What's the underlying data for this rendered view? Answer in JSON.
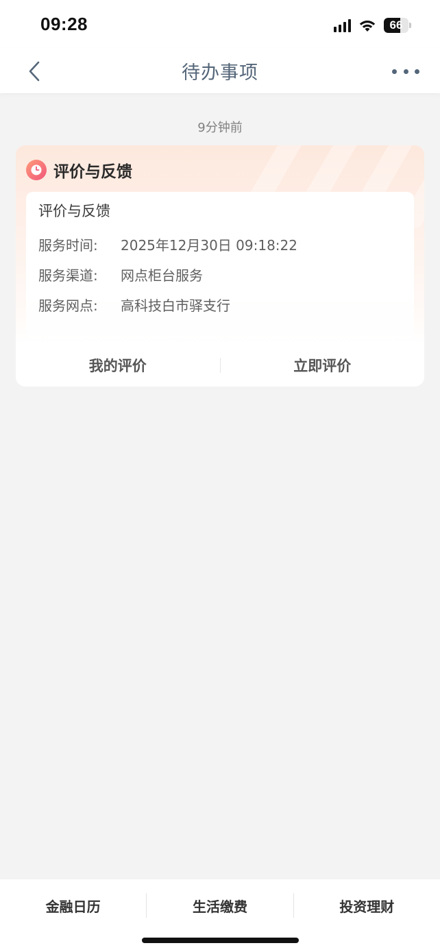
{
  "status_bar": {
    "time": "09:28",
    "battery": "66",
    "icons": [
      "signal-icon",
      "wifi-icon",
      "battery-icon"
    ]
  },
  "nav": {
    "title": "待办事项",
    "back_icon": "chevron-left-icon",
    "more_icon": "more-dots-icon"
  },
  "timestamp": "9分钟前",
  "card": {
    "icon": "clock-icon",
    "header_title": "评价与反馈",
    "body_title": "评价与反馈",
    "rows": [
      {
        "label": "服务时间:",
        "value": "2025年12月30日 09:18:22"
      },
      {
        "label": "服务渠道:",
        "value": "网点柜台服务"
      },
      {
        "label": "服务网点:",
        "value": "高科技白市驿支行"
      }
    ],
    "actions": {
      "my_review": "我的评价",
      "review_now": "立即评价"
    }
  },
  "bottom_tabs": [
    "金融日历",
    "生活缴费",
    "投资理财"
  ],
  "colors": {
    "nav_title": "#546679",
    "card_gradient_top": "#fde8dd",
    "icon_gradient_start": "#ff9a7a",
    "icon_gradient_end": "#f0577a",
    "page_bg": "#f3f3f3"
  }
}
